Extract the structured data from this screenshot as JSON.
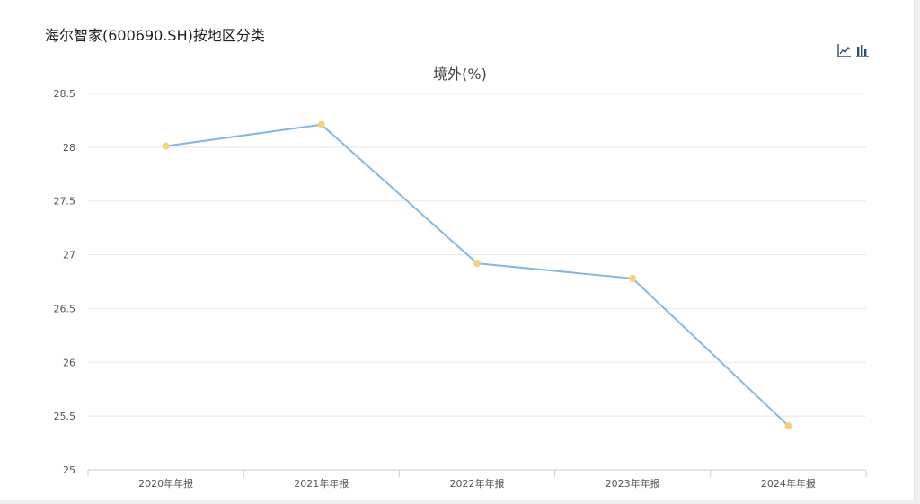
{
  "page": {
    "title": "海尔智家(600690.SH)按地区分类"
  },
  "toolbox": {
    "line_icon": "line-chart-icon",
    "bar_icon": "bar-chart-icon"
  },
  "colors": {
    "line": "#85b8e2",
    "point": "#f7d07a",
    "grid": "#e8e8e8",
    "axis": "#cccccc"
  },
  "chart_data": {
    "type": "line",
    "title": "境外(%)",
    "categories": [
      "2020年年报",
      "2021年年报",
      "2022年年报",
      "2023年年报",
      "2024年年报"
    ],
    "series": [
      {
        "values": [
          28.01,
          28.21,
          26.92,
          26.78,
          25.41
        ]
      }
    ],
    "ylim": [
      25,
      28.5
    ],
    "yticks": [
      "25",
      "25.5",
      "26",
      "26.5",
      "27",
      "27.5",
      "28",
      "28.5"
    ],
    "grid": true,
    "legend": "none"
  }
}
